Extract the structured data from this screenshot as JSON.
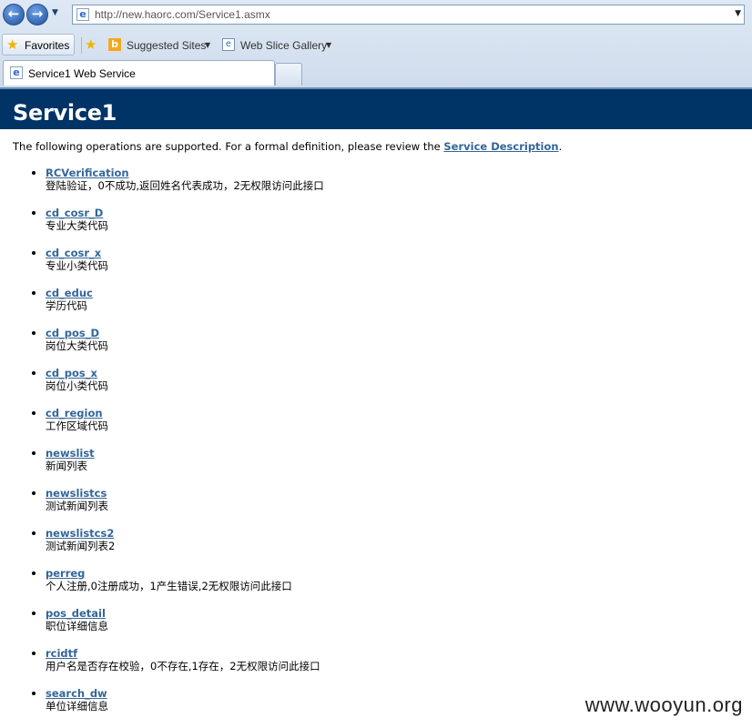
{
  "browser": {
    "address_url": "http://new.haorc.com/Service1.asmx",
    "favorites_label": "Favorites",
    "suggested_sites_label": "Suggested Sites",
    "web_slice_gallery_label": "Web Slice Gallery",
    "tab_title": "Service1 Web Service"
  },
  "page": {
    "title": "Service1",
    "intro_text": "The following operations are supported. For a formal definition, please review the ",
    "intro_link": "Service Description",
    "intro_end": ".",
    "operations": [
      {
        "name": "RCVerification",
        "desc": "登陆验证，0不成功,返回姓名代表成功，2无权限访问此接口"
      },
      {
        "name": "cd_cosr_D",
        "desc": "专业大类代码"
      },
      {
        "name": "cd_cosr_x",
        "desc": "专业小类代码"
      },
      {
        "name": "cd_educ",
        "desc": "学历代码"
      },
      {
        "name": "cd_pos_D",
        "desc": "岗位大类代码"
      },
      {
        "name": "cd_pos_x",
        "desc": "岗位小类代码"
      },
      {
        "name": "cd_region",
        "desc": "工作区域代码"
      },
      {
        "name": "newslist",
        "desc": "新闻列表"
      },
      {
        "name": "newslistcs",
        "desc": "测试新闻列表"
      },
      {
        "name": "newslistcs2",
        "desc": "测试新闻列表2"
      },
      {
        "name": "perreg",
        "desc": "个人注册,0注册成功，1产生错误,2无权限访问此接口"
      },
      {
        "name": "pos_detail",
        "desc": "职位详细信息"
      },
      {
        "name": "rcidtf",
        "desc": "用户名是否存在校验，0不存在,1存在，2无权限访问此接口"
      },
      {
        "name": "search_dw",
        "desc": "单位详细信息"
      }
    ]
  },
  "watermark": "www.wooyun.org",
  "colors": {
    "banner": "#003366",
    "link": "#336699"
  }
}
